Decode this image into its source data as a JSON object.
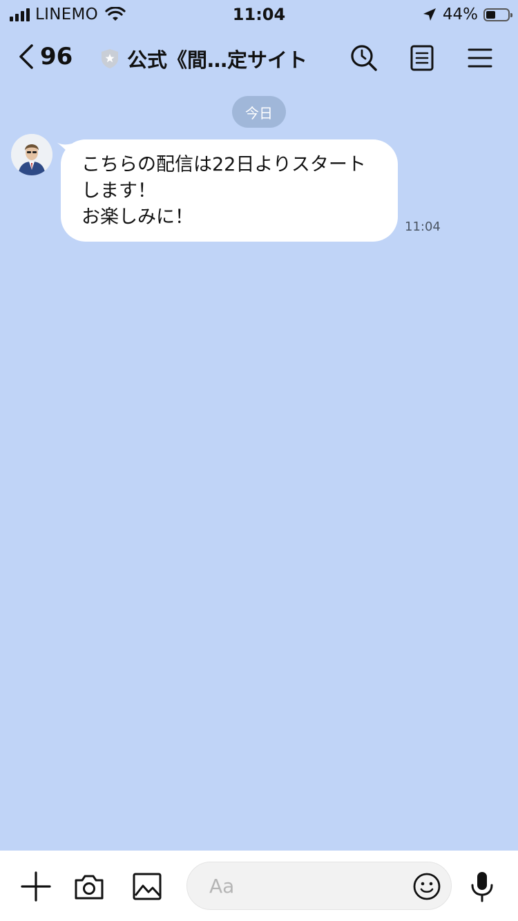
{
  "status_bar": {
    "carrier": "LINEMO",
    "time": "11:04",
    "battery_percent": "44%",
    "battery_level": 0.44,
    "icons": [
      "signal-icon",
      "wifi-icon",
      "location-arrow-icon",
      "battery-icon"
    ]
  },
  "header": {
    "back_count": "96",
    "title": "公式《間…定サイト",
    "icons": [
      "chevron-left-icon",
      "official-badge-icon",
      "search-icon",
      "notes-icon",
      "menu-icon"
    ]
  },
  "chat": {
    "date_label": "今日",
    "messages": [
      {
        "text": "こちらの配信は22日よりスタートします！\nお楽しみに！",
        "time": "11:04",
        "bubble_color": "#ffffff"
      }
    ]
  },
  "input_bar": {
    "placeholder": "Aa",
    "icons": [
      "plus-icon",
      "camera-icon",
      "image-icon",
      "emoji-icon",
      "microphone-icon"
    ]
  },
  "colors": {
    "chat_background": "#c0d4f7",
    "date_pill": "#a0b7d9",
    "bubble": "#ffffff",
    "input_bar": "#ffffff"
  }
}
